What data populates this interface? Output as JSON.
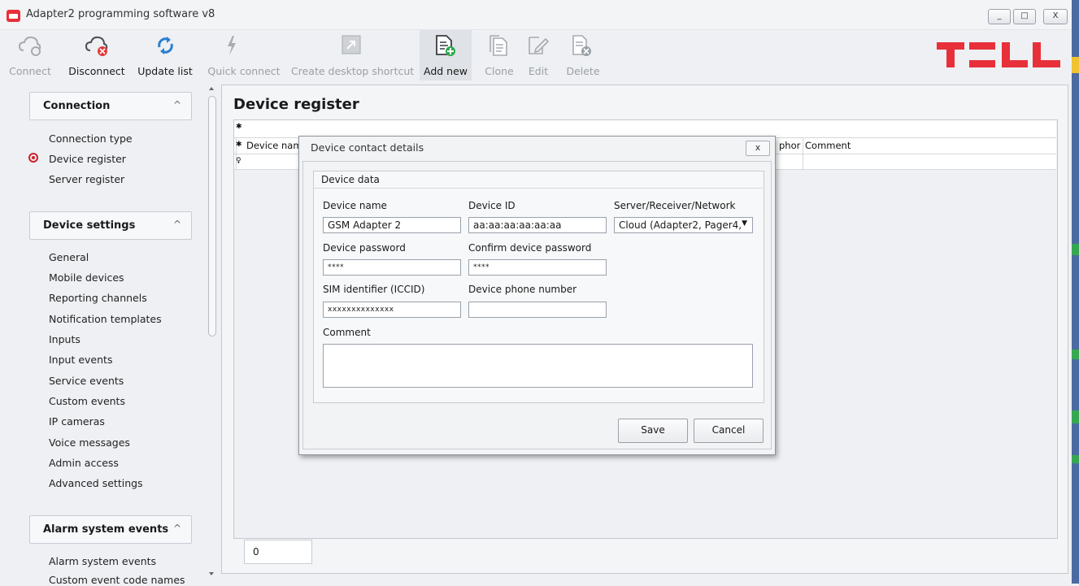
{
  "window": {
    "title": "Adapter2 programming software v8",
    "controls": [
      "_",
      "□",
      "X"
    ]
  },
  "toolbar": {
    "connect": "Connect",
    "disconnect": "Disconnect",
    "update_list": "Update list",
    "quick_connect": "Quick connect",
    "create_shortcut": "Create desktop shortcut",
    "add_new": "Add new",
    "clone": "Clone",
    "edit": "Edit",
    "delete": "Delete"
  },
  "logo": {
    "text": "TELL",
    "color": "#e8303a"
  },
  "sidebar": {
    "connection": {
      "title": "Connection",
      "items": [
        "Connection type",
        "Device register",
        "Server register"
      ],
      "selected": "Device register"
    },
    "device_settings": {
      "title": "Device settings",
      "items": [
        "General",
        "Mobile devices",
        "Reporting channels",
        "Notification templates",
        "Inputs",
        "Input events",
        "Service events",
        "Custom events",
        "IP cameras",
        "Voice messages",
        "Admin access",
        "Advanced settings"
      ]
    },
    "alarm_system_events": {
      "title": "Alarm system events",
      "items": [
        "Alarm system events",
        "Custom event code names"
      ]
    },
    "collapse_icon": "^"
  },
  "main": {
    "title": "Device register",
    "grid": {
      "row_markers": [
        "✱",
        "✱",
        "♀"
      ],
      "header_left": "Device nam",
      "header_right_partial": "phor",
      "header_comment": "Comment"
    },
    "footer_count": "0"
  },
  "dialog": {
    "title": "Device contact details",
    "close": "x",
    "group_title": "Device data",
    "fields": {
      "device_name": {
        "label": "Device name",
        "value": "GSM Adapter 2"
      },
      "device_id": {
        "label": "Device ID",
        "value": "aa:aa:aa:aa:aa:aa"
      },
      "server": {
        "label": "Server/Receiver/Network",
        "value": "Cloud (Adapter2, Pager4,"
      },
      "device_password": {
        "label": "Device password",
        "value": "****"
      },
      "confirm_password": {
        "label": "Confirm device password",
        "value": "****"
      },
      "sim_id": {
        "label": "SIM identifier (ICCID)",
        "value": "xxxxxxxxxxxxxx"
      },
      "phone": {
        "label": "Device phone number",
        "value": ""
      },
      "comment": {
        "label": "Comment",
        "value": ""
      }
    },
    "save": "Save",
    "cancel": "Cancel"
  }
}
